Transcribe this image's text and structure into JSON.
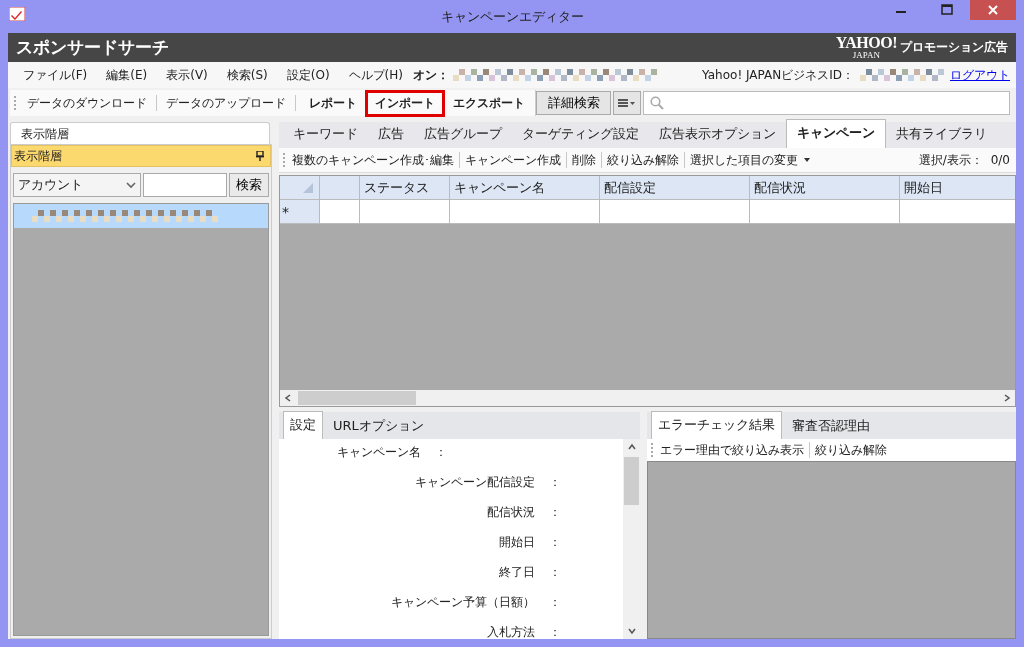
{
  "window": {
    "title": "キャンペーンエディター"
  },
  "header": {
    "title": "スポンサードサーチ",
    "brand": "YAHOO!",
    "brand_sub": "JAPAN",
    "tagline": "プロモーション広告"
  },
  "menu": {
    "items": [
      "ファイル(F)",
      "編集(E)",
      "表示(V)",
      "検索(S)",
      "設定(O)",
      "ヘルプ(H)"
    ],
    "account_label": "オン：",
    "business_id_label": "Yahoo! JAPANビジネスID：",
    "logout": "ログアウト"
  },
  "toolbar": {
    "items": [
      {
        "label": "データのダウンロード",
        "kind": "plain",
        "highlighted": false
      },
      {
        "label": "データのアップロード",
        "kind": "plain",
        "highlighted": false
      },
      {
        "label": "レポート",
        "kind": "bold",
        "highlighted": false
      },
      {
        "label": "インポート",
        "kind": "bold",
        "highlighted": true
      },
      {
        "label": "エクスポート",
        "kind": "bold",
        "highlighted": false
      }
    ],
    "detail_search": "詳細検索"
  },
  "sidebar": {
    "tab": "表示階層",
    "pane_title": "表示階層",
    "filter_value": "アカウント",
    "search_button": "検索",
    "tree": [
      {
        "selected": true
      }
    ]
  },
  "tabs": [
    {
      "label": "キーワード",
      "selected": false
    },
    {
      "label": "広告",
      "selected": false
    },
    {
      "label": "広告グループ",
      "selected": false
    },
    {
      "label": "ターゲティング設定",
      "selected": false
    },
    {
      "label": "広告表示オプション",
      "selected": false
    },
    {
      "label": "キャンペーン",
      "selected": true
    },
    {
      "label": "共有ライブラリ",
      "selected": false
    }
  ],
  "grid_toolbar": {
    "items": [
      {
        "label": "複数のキャンペーン作成･編集",
        "kind": "plain"
      },
      {
        "label": "キャンペーン作成",
        "kind": "plain"
      },
      {
        "label": "削除",
        "kind": "plain"
      },
      {
        "label": "絞り込み解除",
        "kind": "plain"
      },
      {
        "label": "選択した項目の変更",
        "kind": "dropdown"
      }
    ],
    "selection_label": "選択/表示：",
    "selection_count": "0/0"
  },
  "table": {
    "columns": [
      "ステータス",
      "キャンペーン名",
      "配信設定",
      "配信状況",
      "開始日"
    ],
    "new_row_marker": "*"
  },
  "detail": {
    "tabs": [
      {
        "label": "設定",
        "selected": true
      },
      {
        "label": "URLオプション",
        "selected": false
      }
    ],
    "fields": [
      {
        "label": "キャンペーン名",
        "separator": "：",
        "kind": "top"
      },
      {
        "label": "キャンペーン配信設定",
        "separator": "：",
        "kind": "normal"
      },
      {
        "label": "配信状況",
        "separator": "：",
        "kind": "normal"
      },
      {
        "label": "開始日",
        "separator": "：",
        "kind": "normal"
      },
      {
        "label": "終了日",
        "separator": "：",
        "kind": "normal"
      },
      {
        "label": "キャンペーン予算（日額）",
        "separator": "：",
        "kind": "normal"
      },
      {
        "label": "入札方法",
        "separator": "：",
        "kind": "normal"
      }
    ]
  },
  "errors": {
    "tabs": [
      {
        "label": "エラーチェック結果",
        "selected": true
      },
      {
        "label": "審査否認理由",
        "selected": false
      }
    ],
    "toolbar": [
      "エラー理由で絞り込み表示",
      "絞り込み解除"
    ]
  }
}
